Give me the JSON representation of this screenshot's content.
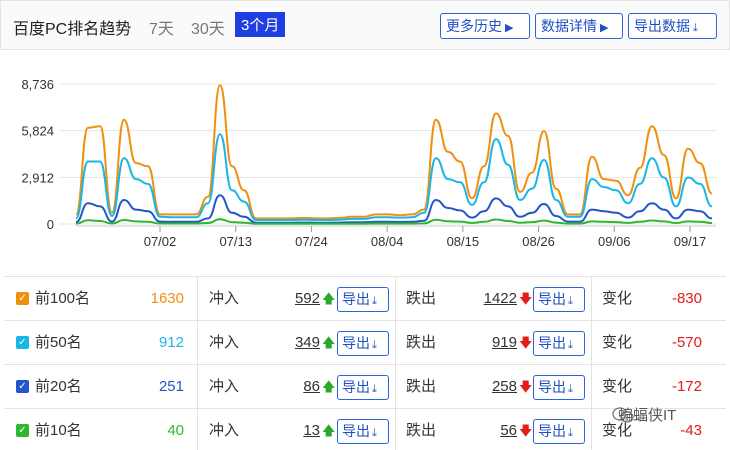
{
  "header": {
    "title": "百度PC排名趋势",
    "periods": [
      "7天",
      "30天",
      "3个月"
    ],
    "buttons": {
      "history": "更多历史",
      "details": "数据详情",
      "export": "导出数据"
    }
  },
  "chart_data": {
    "type": "line",
    "title": "",
    "xlabel": "",
    "ylabel": "",
    "ylim": [
      0,
      8736
    ],
    "yticks": [
      "8,736",
      "5,824",
      "2,912",
      "0"
    ],
    "xticks": [
      "07/02",
      "07/13",
      "07/24",
      "08/04",
      "08/15",
      "08/26",
      "09/06",
      "09/17"
    ],
    "grid": true,
    "series": [
      {
        "color": "#f0900f",
        "values": [
          600,
          6000,
          6100,
          700,
          6500,
          3800,
          3600,
          600,
          600,
          600,
          600,
          1700,
          8650,
          3600,
          2100,
          350,
          350,
          350,
          350,
          380,
          350,
          350,
          380,
          450,
          450,
          600,
          600,
          550,
          600,
          900,
          6500,
          4500,
          3900,
          1600,
          3600,
          6900,
          5500,
          2000,
          3200,
          5800,
          2200,
          600,
          600,
          4200,
          2800,
          2700,
          1800,
          3500,
          6100,
          4300,
          1600,
          4700,
          3800,
          1900
        ]
      },
      {
        "color": "#1ab6e6",
        "values": [
          350,
          3900,
          3900,
          500,
          4100,
          2800,
          2500,
          450,
          420,
          420,
          420,
          1300,
          5600,
          2100,
          1400,
          250,
          250,
          250,
          250,
          270,
          250,
          250,
          270,
          320,
          320,
          420,
          420,
          400,
          420,
          700,
          4100,
          2800,
          2600,
          1200,
          2600,
          5300,
          3700,
          1500,
          2200,
          4000,
          1500,
          450,
          450,
          2800,
          2300,
          2100,
          1300,
          2500,
          4100,
          2900,
          1100,
          2900,
          2500,
          1100
        ]
      },
      {
        "color": "#2455c9",
        "values": [
          120,
          1300,
          1100,
          150,
          1500,
          900,
          800,
          150,
          140,
          140,
          140,
          350,
          1800,
          700,
          450,
          80,
          80,
          80,
          80,
          90,
          80,
          80,
          90,
          110,
          110,
          140,
          140,
          130,
          140,
          200,
          1500,
          1000,
          850,
          400,
          800,
          1600,
          1100,
          450,
          700,
          1250,
          500,
          150,
          150,
          900,
          800,
          700,
          400,
          800,
          1300,
          900,
          350,
          900,
          800,
          350
        ]
      },
      {
        "color": "#2eb82e",
        "values": [
          20,
          230,
          190,
          30,
          250,
          160,
          140,
          30,
          30,
          30,
          30,
          60,
          300,
          120,
          80,
          15,
          15,
          15,
          15,
          15,
          15,
          15,
          15,
          20,
          20,
          25,
          25,
          25,
          25,
          35,
          260,
          170,
          150,
          70,
          140,
          280,
          190,
          80,
          120,
          210,
          90,
          25,
          25,
          160,
          140,
          120,
          70,
          140,
          220,
          160,
          60,
          160,
          140,
          60
        ]
      }
    ]
  },
  "table": {
    "labels": {
      "in": "冲入",
      "out": "跌出",
      "change": "变化",
      "export": "导出"
    },
    "rows": [
      {
        "name": "前100名",
        "value": "1630",
        "value_color": "#f0900f",
        "cb_color": "#f0900f",
        "in": "592",
        "out": "1422",
        "change": "-830"
      },
      {
        "name": "前50名",
        "value": "912",
        "value_color": "#1ab6e6",
        "cb_color": "#1ab6e6",
        "in": "349",
        "out": "919",
        "change": "-570"
      },
      {
        "name": "前20名",
        "value": "251",
        "value_color": "#2455c9",
        "cb_color": "#2455c9",
        "in": "86",
        "out": "258",
        "change": "-172"
      },
      {
        "name": "前10名",
        "value": "40",
        "value_color": "#2eb82e",
        "cb_color": "#2eb82e",
        "in": "13",
        "out": "56",
        "change": "-43"
      }
    ]
  },
  "watermark": "蝙蝠侠IT"
}
